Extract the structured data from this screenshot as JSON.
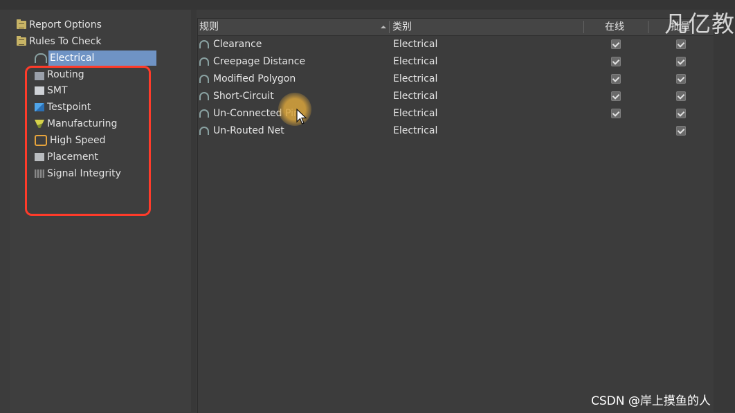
{
  "tree": {
    "items": [
      {
        "label": "Report Options",
        "icon": "folder-icon"
      },
      {
        "label": "Rules To Check",
        "icon": "folder-icon"
      },
      {
        "label": "Electrical",
        "icon": "electrical-icon",
        "selected": true
      },
      {
        "label": "Routing",
        "icon": "routing-icon"
      },
      {
        "label": "SMT",
        "icon": "smt-icon"
      },
      {
        "label": "Testpoint",
        "icon": "testpoint-icon"
      },
      {
        "label": "Manufacturing",
        "icon": "manufacturing-icon"
      },
      {
        "label": "High Speed",
        "icon": "high-speed-icon"
      },
      {
        "label": "Placement",
        "icon": "placement-icon"
      },
      {
        "label": "Signal Integrity",
        "icon": "signal-integrity-icon"
      }
    ]
  },
  "grid": {
    "headers": {
      "rule": "规则",
      "category": "类别",
      "online": "在线",
      "batch": "批量"
    },
    "rows": [
      {
        "rule": "Clearance",
        "category": "Electrical",
        "online": true,
        "batch": true
      },
      {
        "rule": "Creepage Distance",
        "category": "Electrical",
        "online": true,
        "batch": true
      },
      {
        "rule": "Modified Polygon",
        "category": "Electrical",
        "online": true,
        "batch": true
      },
      {
        "rule": "Short-Circuit",
        "category": "Electrical",
        "online": true,
        "batch": true
      },
      {
        "rule": "Un-Connected Pin",
        "category": "Electrical",
        "online": true,
        "batch": true
      },
      {
        "rule": "Un-Routed Net",
        "category": "Electrical",
        "online": false,
        "batch": true
      }
    ]
  },
  "watermarks": {
    "top": "凡亿教",
    "bottom": "CSDN @岸上摸鱼的人"
  },
  "colors": {
    "selection": "#6f93c4",
    "highlight_box": "#ff3b2a"
  }
}
